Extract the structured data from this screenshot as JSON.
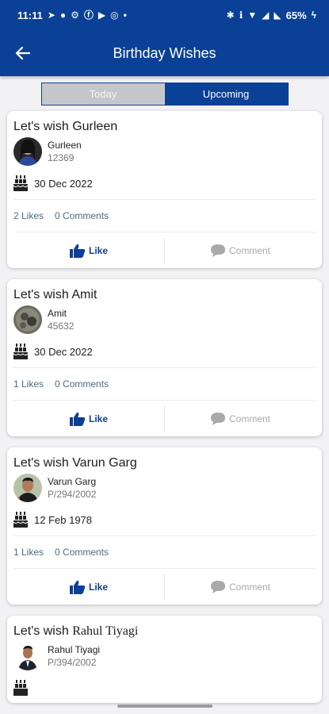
{
  "status_bar": {
    "time": "11:11",
    "battery": "65%",
    "left_icons": [
      "telegram-icon",
      "signal-app-icon",
      "vpn-icon",
      "facebook-icon",
      "youtube-icon",
      "radio-icon",
      "dot-icon"
    ],
    "right_icons": [
      "bluetooth-icon",
      "volte-icon",
      "wifi-icon",
      "mobile-signal-icon",
      "no-signal-icon",
      "charging-icon"
    ]
  },
  "app_bar": {
    "title": "Birthday Wishes",
    "back_icon": "arrow-left-icon"
  },
  "tabs": {
    "today": "Today",
    "upcoming": "Upcoming",
    "active": "upcoming"
  },
  "colors": {
    "primary": "#0a4096",
    "tab_inactive": "#c5c6c9",
    "background": "#f2f2f4",
    "muted_text": "#767676",
    "stats_text": "#4e6a80",
    "comment_gray": "#a9a9a9"
  },
  "cards": [
    {
      "title": "Let's wish Gurleen",
      "name": "Gurleen",
      "code": "12369",
      "dob": "30 Dec 2022",
      "likes": "2 Likes",
      "comments": "0 Comments",
      "like_label": "Like",
      "comment_label": "Comment"
    },
    {
      "title": "Let's wish Amit",
      "name": "Amit",
      "code": "45632",
      "dob": "30 Dec 2022",
      "likes": "1 Likes",
      "comments": "0 Comments",
      "like_label": "Like",
      "comment_label": "Comment"
    },
    {
      "title": "Let's wish Varun Garg",
      "name": "Varun Garg",
      "code": "P/294/2002",
      "dob": "12 Feb 1978",
      "likes": "1 Likes",
      "comments": "0 Comments",
      "like_label": "Like",
      "comment_label": "Comment"
    },
    {
      "title_prefix": "Let's wish",
      "title_name": "Rahul Tiyagi",
      "name": "Rahul Tiyagi",
      "code": "P/394/2002"
    }
  ]
}
